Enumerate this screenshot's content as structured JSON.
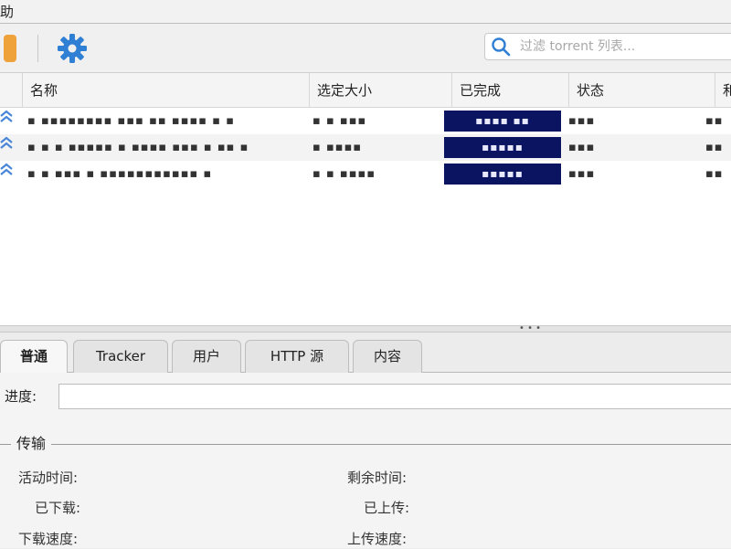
{
  "menubar": {
    "items": [
      "助"
    ]
  },
  "toolbar": {
    "search": {
      "placeholder": "过滤 torrent 列表..."
    }
  },
  "colors": {
    "accent_orange": "#f0a23a",
    "gear_blue": "#2f7fd4",
    "progress_navy": "#0b1460"
  },
  "list": {
    "columns": [
      "名称",
      "选定大小",
      "已完成",
      "状态",
      "和"
    ],
    "rows": [
      {
        "name": "▪ ▪▪▪▪▪▪▪▪ ▪▪▪ ▪▪ ▪▪▪▪ ▪ ▪",
        "size": "▪ ▪ ▪▪▪",
        "progress": "▪▪▪▪ ▪▪",
        "state": "▪▪▪",
        "extra": "▪▪"
      },
      {
        "name": "▪ ▪ ▪ ▪▪▪▪▪ ▪ ▪▪▪▪ ▪▪▪ ▪ ▪▪ ▪",
        "size": "▪ ▪▪▪▪",
        "progress": "▪▪▪▪▪",
        "state": "▪▪▪",
        "extra": "▪▪"
      },
      {
        "name": "▪ ▪ ▪▪▪ ▪ ▪▪▪▪▪▪▪▪▪▪▪ ▪",
        "size": "▪ ▪ ▪▪▪▪",
        "progress": "▪▪▪▪▪",
        "state": "▪▪▪",
        "extra": "▪▪"
      }
    ]
  },
  "tabs": [
    {
      "label": "普通",
      "active": true
    },
    {
      "label": "Tracker",
      "active": false
    },
    {
      "label": "用户",
      "active": false
    },
    {
      "label": "HTTP 源",
      "active": false
    },
    {
      "label": "内容",
      "active": false
    }
  ],
  "general": {
    "progress_label": "进度:",
    "group_title": "传输",
    "active_time_label": "活动时间:",
    "remaining_label": "剩余时间:",
    "downloaded_label": "已下载:",
    "uploaded_label": "已上传:",
    "dl_speed_label": "下载速度:",
    "ul_speed_label": "上传速度:"
  }
}
